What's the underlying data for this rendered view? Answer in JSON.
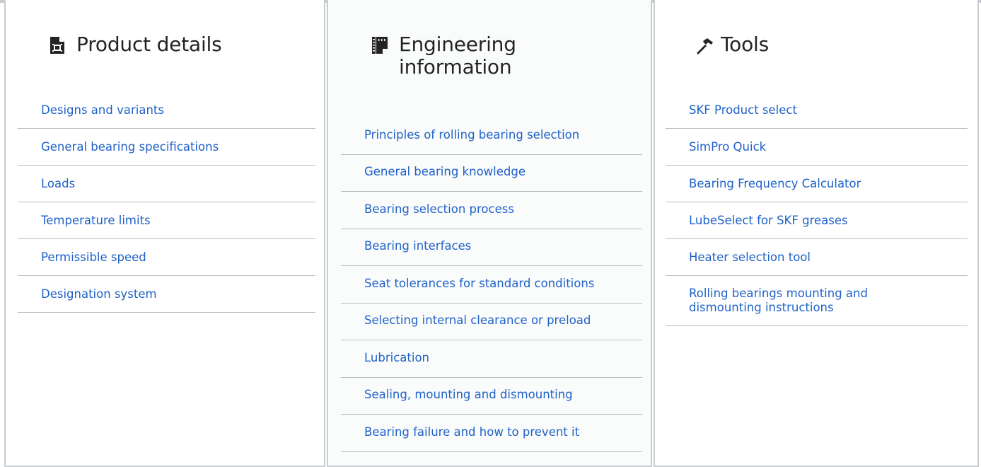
{
  "columns": [
    {
      "title": "Product details",
      "icon": "document-icon",
      "links": [
        "Designs and variants",
        "General bearing specifications",
        "Loads",
        "Temperature limits",
        "Permissible speed",
        "Designation system"
      ]
    },
    {
      "title": "Engineering information",
      "icon": "ruler-notebook-icon",
      "links": [
        "Principles of rolling bearing selection",
        "General bearing knowledge",
        "Bearing selection process",
        "Bearing interfaces",
        "Seat tolerances for standard conditions",
        "Selecting internal clearance or preload",
        "Lubrication",
        "Sealing, mounting and dismounting",
        "Bearing failure and how to prevent it"
      ]
    },
    {
      "title": "Tools",
      "icon": "hammer-icon",
      "links": [
        "SKF Product select",
        "SimPro Quick",
        "Bearing Frequency Calculator",
        "LubeSelect for SKF greases",
        "Heater selection tool",
        "Rolling bearings mounting and dismounting instructions"
      ]
    }
  ],
  "colors": {
    "link": "#1f62c9",
    "title": "#242424",
    "divider": "#b9bcc0",
    "border": "#c8ccd1"
  }
}
